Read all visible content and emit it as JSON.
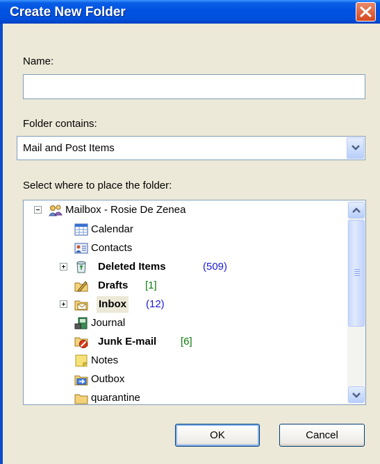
{
  "window": {
    "title": "Create New Folder"
  },
  "name_field": {
    "label": "Name:",
    "value": ""
  },
  "folder_contains": {
    "label": "Folder contains:",
    "selected": "Mail and Post Items"
  },
  "location": {
    "label": "Select where to place the folder:",
    "tree": [
      {
        "label": "Mailbox - Rosie De Zenea",
        "count": "",
        "icon": "mailbox-icon",
        "bold": false
      },
      {
        "label": "Calendar",
        "count": "",
        "icon": "calendar-icon",
        "bold": false
      },
      {
        "label": "Contacts",
        "count": "",
        "icon": "contacts-icon",
        "bold": false
      },
      {
        "label": "Deleted Items",
        "count": "(509)",
        "icon": "trash-icon",
        "bold": true
      },
      {
        "label": "Drafts",
        "count": "[1]",
        "icon": "drafts-icon",
        "bold": true
      },
      {
        "label": "Inbox",
        "count": "(12)",
        "icon": "inbox-icon",
        "bold": true
      },
      {
        "label": "Journal",
        "count": "",
        "icon": "journal-icon",
        "bold": false
      },
      {
        "label": "Junk E-mail",
        "count": "[6]",
        "icon": "junk-icon",
        "bold": true
      },
      {
        "label": "Notes",
        "count": "",
        "icon": "notes-icon",
        "bold": false
      },
      {
        "label": "Outbox",
        "count": "",
        "icon": "outbox-icon",
        "bold": false
      },
      {
        "label": "quarantine",
        "count": "",
        "icon": "folder-icon",
        "bold": false
      }
    ]
  },
  "buttons": {
    "ok": "OK",
    "cancel": "Cancel"
  },
  "colors": {
    "titlebar": "#0053e1",
    "count_blue": "#1a1ad6",
    "count_green": "#0d7d0d",
    "dialog_bg": "#ece9d8"
  }
}
